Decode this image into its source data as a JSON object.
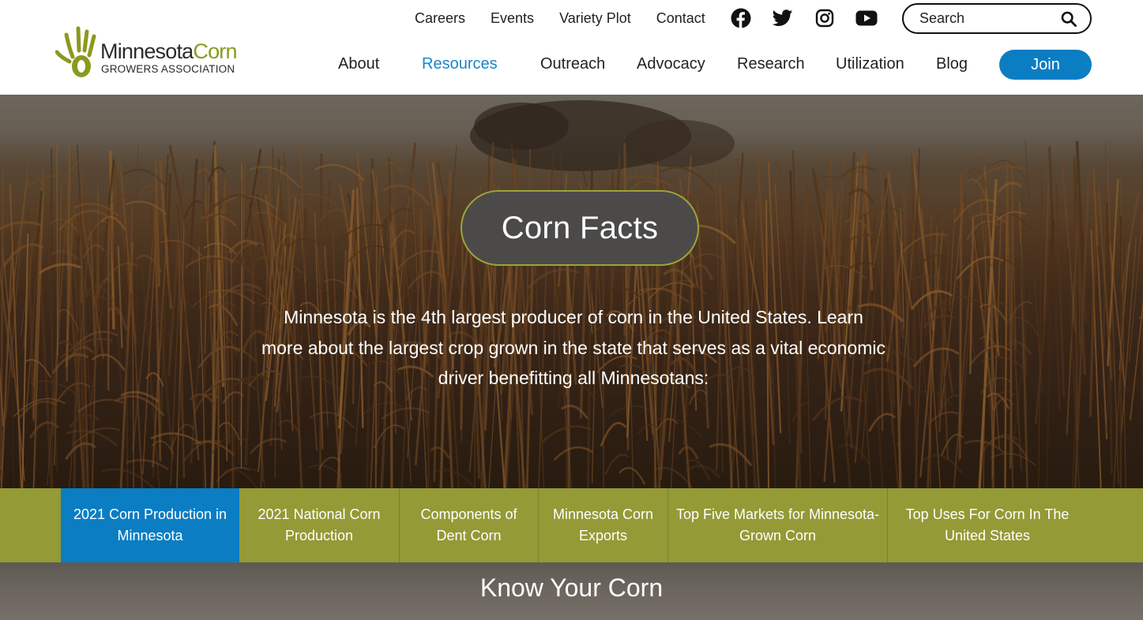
{
  "logo": {
    "word1": "Minnesota",
    "word2": "Corn",
    "subtitle": "GROWERS ASSOCIATION",
    "brand_green": "#8a9a1f"
  },
  "utility_nav": [
    {
      "label": "Careers"
    },
    {
      "label": "Events"
    },
    {
      "label": "Variety Plot"
    },
    {
      "label": "Contact"
    }
  ],
  "social": [
    {
      "name": "facebook-icon"
    },
    {
      "name": "twitter-icon"
    },
    {
      "name": "instagram-icon"
    },
    {
      "name": "youtube-icon"
    }
  ],
  "search": {
    "placeholder": "Search",
    "icon": "search-icon"
  },
  "main_nav": [
    {
      "label": "About",
      "active": false
    },
    {
      "label": "Resources",
      "active": true
    },
    {
      "label": "Outreach",
      "active": false
    },
    {
      "label": "Advocacy",
      "active": false
    },
    {
      "label": "Research",
      "active": false
    },
    {
      "label": "Utilization",
      "active": false
    },
    {
      "label": "Blog",
      "active": false
    }
  ],
  "join": {
    "label": "Join",
    "color": "#0b7dc3"
  },
  "hero": {
    "title": "Corn Facts",
    "text": "Minnesota is the 4th largest producer of corn in the United States. Learn more about the largest crop grown in the state that serves as a vital economic driver benefitting all Minnesotans:"
  },
  "tabs": [
    {
      "label": "2021 Corn Production in Minnesota",
      "active": true
    },
    {
      "label": "2021 National Corn Production",
      "active": false
    },
    {
      "label": "Components of Dent Corn",
      "active": false
    },
    {
      "label": "Minnesota Corn Exports",
      "active": false
    },
    {
      "label": "Top Five Markets for Minnesota-Grown Corn",
      "active": false
    },
    {
      "label": "Top Uses For Corn In The United States",
      "active": false
    }
  ],
  "colors": {
    "tab_bar": "#939a36",
    "active_tab": "#0b7dc3",
    "active_nav": "#1a86c7"
  },
  "section": {
    "heading": "Know Your Corn"
  }
}
